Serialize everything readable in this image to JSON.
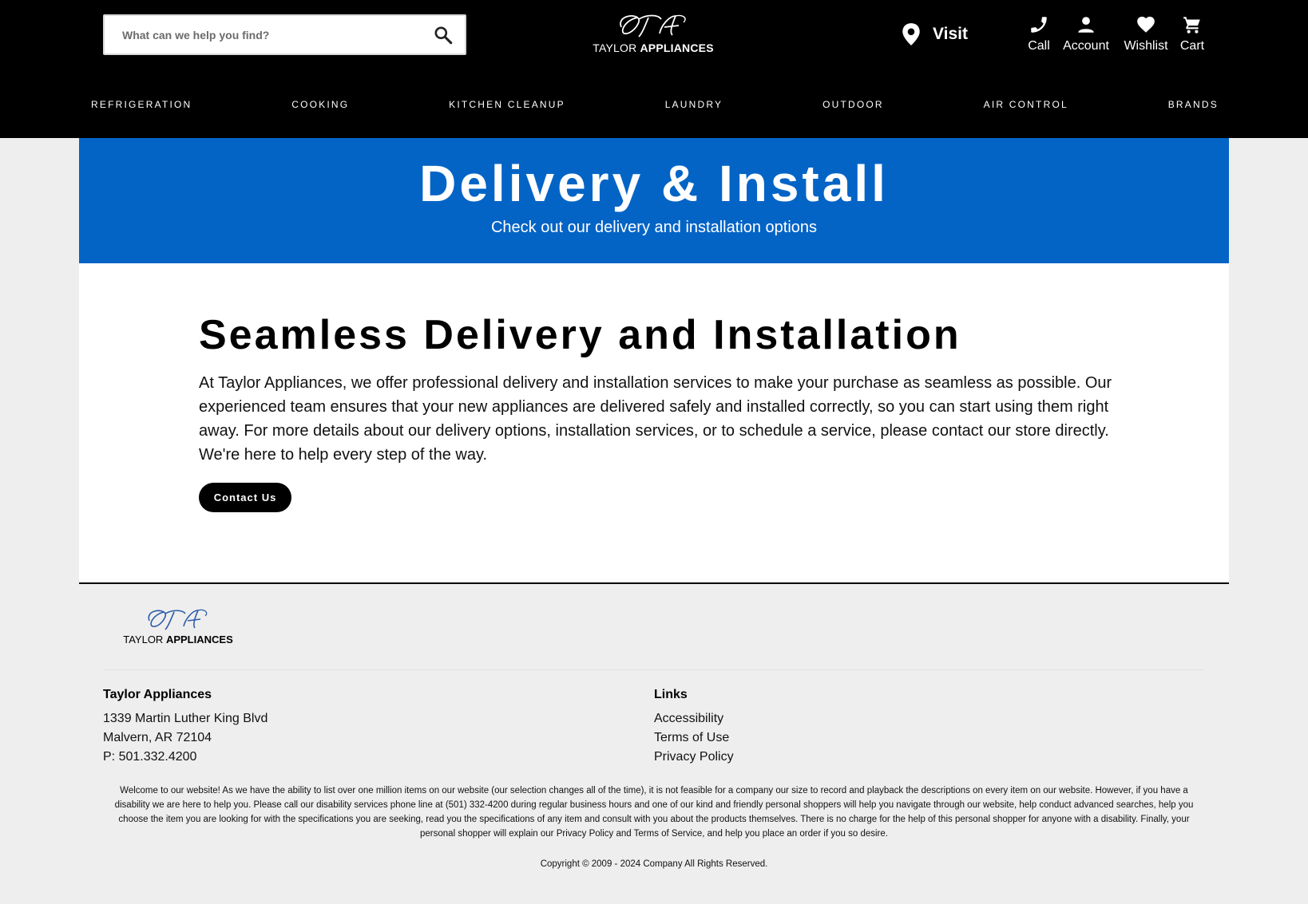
{
  "search": {
    "placeholder": "What can we help you find?"
  },
  "brand": {
    "monogram": "TCA",
    "name_light": "TAYLOR",
    "name_bold": "APPLIANCES"
  },
  "header": {
    "visit_label": "Visit",
    "utility": [
      {
        "label": "Call",
        "icon": "phone-icon"
      },
      {
        "label": "Account",
        "icon": "person-icon"
      },
      {
        "label": "Wishlist",
        "icon": "heart-icon"
      },
      {
        "label": "Cart",
        "icon": "cart-icon"
      }
    ]
  },
  "nav": [
    "REFRIGERATION",
    "COOKING",
    "KITCHEN CLEANUP",
    "LAUNDRY",
    "OUTDOOR",
    "AIR CONTROL",
    "BRANDS"
  ],
  "hero": {
    "title": "Delivery & Install",
    "subtitle": "Check out our delivery and installation options"
  },
  "content": {
    "heading": "Seamless Delivery and Installation",
    "body": "At Taylor Appliances, we offer professional delivery and installation services to make your purchase as seamless as possible. Our experienced team ensures that your new appliances are delivered safely and installed correctly, so you can start using them right away. For more details about our delivery options, installation services, or to schedule a service, please contact our store directly. We're here to help every step of the way.",
    "button": "Contact Us"
  },
  "footer": {
    "store": {
      "heading": "Taylor Appliances",
      "address1": "1339 Martin Luther King Blvd",
      "address2": "Malvern, AR 72104",
      "phone": "P: 501.332.4200"
    },
    "links": {
      "heading": "Links",
      "items": [
        "Accessibility",
        "Terms of Use",
        "Privacy Policy"
      ]
    },
    "disclaimer": "Welcome to our website! As we have the ability to list over one million items on our website (our selection changes all of the time), it is not feasible for a company our size to record and playback the descriptions on every item on our website. However, if you have a disability we are here to help you. Please call our disability services phone line at (501) 332-4200 during regular business hours and one of our kind and friendly personal shoppers will help you navigate through our website, help conduct advanced searches, help you choose the item you are looking for with the specifications you are seeking, read you the specifications of any item and consult with you about the products themselves. There is no charge for the help of this personal shopper for anyone with a disability. Finally, your personal shopper will explain our Privacy Policy and Terms of Service, and help you place an order if you so desire.",
    "copyright": "Copyright © 2009 - 2024 Company All Rights Reserved."
  },
  "colors": {
    "header_bg": "#000000",
    "hero_bg": "#0364c6",
    "page_bg": "#eeeeee",
    "logo_script_footer": "#2a5aa8"
  }
}
